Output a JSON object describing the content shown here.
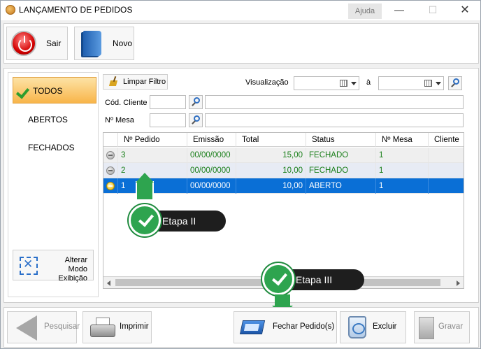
{
  "window": {
    "title": "LANÇAMENTO DE PEDIDOS",
    "help_label": "Ajuda",
    "minimize_glyph": "—",
    "maximize_glyph": "☐",
    "close_glyph": "✕"
  },
  "toolbar_top": {
    "sair_label": "Sair",
    "novo_label": "Novo"
  },
  "sidebar": {
    "items": [
      {
        "label": "TODOS",
        "active": true
      },
      {
        "label": "ABERTOS",
        "active": false
      },
      {
        "label": "FECHADOS",
        "active": false
      }
    ],
    "alterar_label_line1": "Alterar Modo",
    "alterar_label_line2": "Exibição"
  },
  "filters": {
    "limpar_label": "Limpar Filtro",
    "visualizacao_label": "Visualização",
    "ate_label": "à",
    "cliente_label": "Cód. Cliente",
    "mesa_label": "Nº Mesa",
    "date_from": "",
    "date_to": "",
    "cliente_value": "",
    "cliente_name": "",
    "mesa_value": "",
    "mesa_name": ""
  },
  "grid": {
    "columns": [
      "Nº Pedido",
      "Emissão",
      "Total",
      "Status",
      "Nº Mesa",
      "Cliente"
    ],
    "rows": [
      {
        "pedido": "3",
        "emissao": "00/00/0000",
        "total": "15,00",
        "status": "FECHADO",
        "mesa": "1",
        "cliente": "",
        "state": "closed"
      },
      {
        "pedido": "2",
        "emissao": "00/00/0000",
        "total": "10,00",
        "status": "FECHADO",
        "mesa": "1",
        "cliente": "",
        "state": "closed"
      },
      {
        "pedido": "1",
        "emissao": "00/00/0000",
        "total": "10,00",
        "status": "ABERTO",
        "mesa": "1",
        "cliente": "",
        "state": "open",
        "selected": true
      }
    ]
  },
  "callouts": {
    "etapa2": "Etapa II",
    "etapa3": "Etapa III"
  },
  "toolbar_bottom": {
    "pesquisar_label": "Pesquisar",
    "imprimir_label": "Imprimir",
    "fechar_label": "Fechar Pedido(s)",
    "excluir_label": "Excluir",
    "gravar_label": "Gravar"
  },
  "colors": {
    "selection": "#0a6fd6",
    "active_tab": "#f8b54a",
    "status_text": "#1a7f1a",
    "callout_green": "#2ea44f"
  }
}
